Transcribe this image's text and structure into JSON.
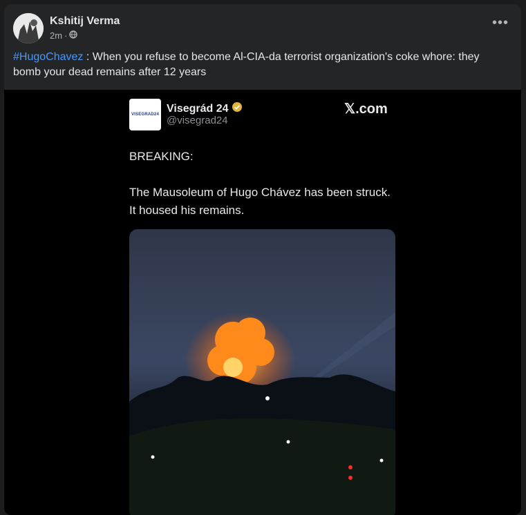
{
  "post": {
    "author": "Kshitij Verma",
    "time": "2m",
    "separator": "·",
    "audience_icon": "globe-icon",
    "more_icon": "more-options-icon",
    "hashtag": "#HugoChavez",
    "caption_text": " : When you refuse to become Al-CIA-da terrorist organization's coke whore: they bomb your dead remains after 12 years"
  },
  "tweet": {
    "logo_text": "VISEGRAD24",
    "display_name": "Visegrád 24",
    "handle": "@visegrad24",
    "source": "𝕏.com",
    "body": "BREAKING:\n\nThe Mausoleum of Hugo Chávez has been struck. It housed his remains.",
    "verified_icon": "verified-badge-icon"
  },
  "colors": {
    "card_bg": "#242526",
    "hashtag": "#4599ff",
    "verified": "#e2b33d",
    "fire": "#ff8a1c"
  }
}
